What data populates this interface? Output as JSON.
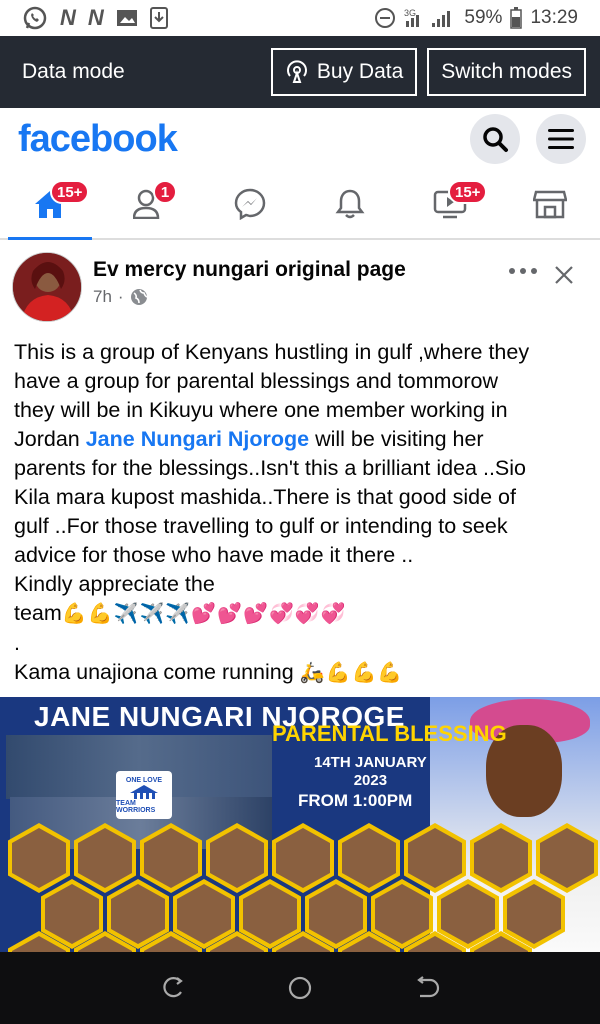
{
  "status_bar": {
    "battery": "59%",
    "time": "13:29",
    "signal_label": "3G"
  },
  "data_bar": {
    "title": "Data mode",
    "buy_data_label": "Buy Data",
    "switch_modes_label": "Switch modes"
  },
  "header": {
    "logo": "facebook"
  },
  "nav": {
    "home_badge": "15+",
    "friends_badge": "1",
    "watch_badge": "15+"
  },
  "post": {
    "author": "Ev mercy nungari original page",
    "time": "7h",
    "separator": "·",
    "more": "•••",
    "line1": "This is a group of Kenyans hustling in gulf ,where they",
    "line2": "have a group for parental blessings   and tommorow",
    "line3": "they will be in Kikuyu where one member working in",
    "line4_pre": "Jordan ",
    "mention": "Jane Nungari Njoroge",
    "line4_post": "   will be visiting her",
    "line5": "parents for the blessings..Isn't this a brilliant idea ..Sio",
    "line6": "Kila mara kupost mashida..There is that good side of",
    "line7": "gulf ..For those travelling to gulf or intending to  seek",
    "line8": "advice for those who have made it there ..",
    "line9": "Kindly appreciate the",
    "line10_text": "team",
    "line10_emoji": "💪💪✈️✈️✈️💕💕💕💞💞💞",
    "line11": ".",
    "line12_text": "Kama unajiona come running ",
    "line12_emoji": "🛵💪💪💪"
  },
  "banner": {
    "title": "JANE NUNGARI NJOROGE",
    "subtitle": "PARENTAL BLESSING",
    "date_line1": "14TH JANUARY",
    "date_line2": "2023",
    "time": "FROM 1:00PM",
    "logo_top": "ONE LOVE",
    "logo_bottom": "TEAM WORRIORS"
  }
}
